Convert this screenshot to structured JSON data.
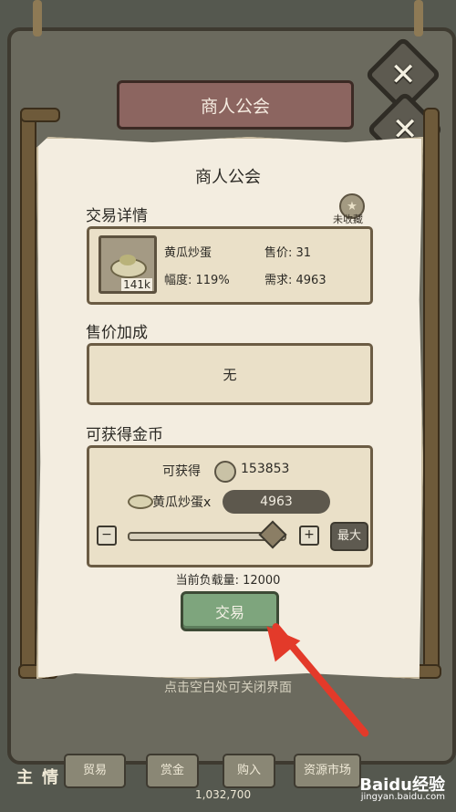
{
  "dialog": {
    "banner_title": "商人公会",
    "title": "商人公会",
    "close_glyph": "✕"
  },
  "trade_details": {
    "section_label": "交易详情",
    "favorite_label": "未收藏",
    "favorite_glyph": "★",
    "item_name": "黄瓜炒蛋",
    "item_quantity": "141k",
    "price_label": "售价: 31",
    "change_label": "幅度: 119%",
    "demand_label": "需求: 4963"
  },
  "price_bonus": {
    "section_label": "售价加成",
    "value": "无"
  },
  "earnings": {
    "section_label": "可获得金币",
    "obtainable_label": "可获得",
    "obtainable_value": "153853",
    "item_label": "黄瓜炒蛋x",
    "quantity_value": "4963",
    "minus_glyph": "−",
    "plus_glyph": "+",
    "max_button": "最大",
    "slider_level": 1.0
  },
  "load_text": "当前负载量: 12000",
  "trade_button": "交易",
  "hint": "点击空白处可关闭界面",
  "bottom_tabs": [
    "贸易",
    "赏金",
    "购入",
    "资源市场"
  ],
  "bottom_side_labels": [
    "主",
    "情"
  ],
  "bottom_counter": "1,032,700",
  "watermark": {
    "brand": "Baidu经验",
    "url": "jingyan.baidu.com"
  },
  "colors": {
    "annotation_arrow": "#e33a2a",
    "trade_button": "#7ea57d",
    "paper": "#f3ede0"
  }
}
